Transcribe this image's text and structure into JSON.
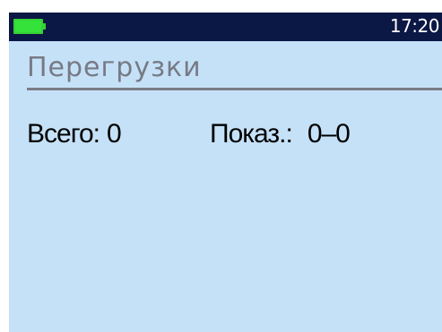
{
  "status_bar": {
    "battery_icon": "battery-full-icon",
    "battery_color": "#35e23a",
    "time": "17:20"
  },
  "title": "Перегрузки",
  "stats": {
    "total_label": "Всего:",
    "total_value": "0",
    "shown_label": "Показ.:",
    "shown_value": "0–0"
  },
  "colors": {
    "screen_background": "#c5e1f7",
    "status_bar_background": "#0b1744",
    "title_text": "#777a86",
    "divider": "#7a7d89"
  }
}
